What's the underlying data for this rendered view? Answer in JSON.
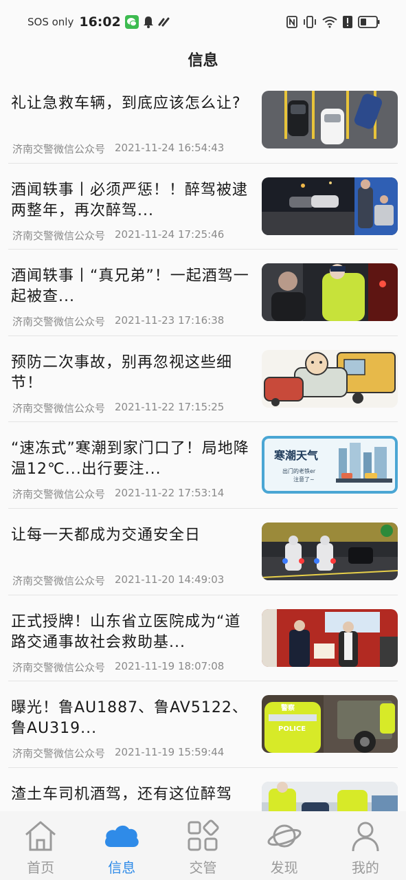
{
  "status_bar": {
    "carrier": "SOS only",
    "time": "16:02"
  },
  "header": {
    "title": "信息"
  },
  "news": [
    {
      "title": "礼让急救车辆，到底应该怎么让?",
      "source": "济南交警微信公众号",
      "time": "2021-11-24 16:54:43",
      "thumb": "parking-cars"
    },
    {
      "title": "酒闻轶事丨必须严惩！！醉驾被逮两整年，再次醉驾...",
      "source": "济南交警微信公众号",
      "time": "2021-11-24 17:25:46",
      "thumb": "night-traffic"
    },
    {
      "title": "酒闻轶事丨“真兄弟”！一起酒驾一起被查...",
      "source": "济南交警微信公众号",
      "time": "2021-11-23 17:16:38",
      "thumb": "police-check"
    },
    {
      "title": "预防二次事故，别再忽视这些细节！",
      "source": "济南交警微信公众号",
      "time": "2021-11-22 17:15:25",
      "thumb": "cartoon-accident"
    },
    {
      "title": "“速冻式”寒潮到家门口了！局地降温12℃...出行要注...",
      "source": "济南交警微信公众号",
      "time": "2021-11-22 17:53:14",
      "thumb": "cold-wave"
    },
    {
      "title": "让每一天都成为交通安全日",
      "source": "济南交警微信公众号",
      "time": "2021-11-20 14:49:03",
      "thumb": "police-motorcycles"
    },
    {
      "title": "正式授牌！山东省立医院成为“道路交通事故社会救助基...",
      "source": "济南交警微信公众号",
      "time": "2021-11-19 18:07:08",
      "thumb": "award-ceremony"
    },
    {
      "title": "曝光！鲁AU1887、鲁AV5122、鲁AU319...",
      "source": "济南交警微信公众号",
      "time": "2021-11-19 15:59:44",
      "thumb": "truck-inspection"
    },
    {
      "title": "渣土车司机酒驾，还有这位醉驾",
      "source": "",
      "time": "",
      "thumb": "drunk-driver"
    }
  ],
  "thumb_text": {
    "cold_wave_title": "寒潮天气",
    "cold_wave_sub1": "出门的老铁er",
    "cold_wave_sub2": "注意了~",
    "police_word": "警察",
    "police_en": "POLICE"
  },
  "tabs": [
    {
      "label": "首页",
      "icon": "home-icon",
      "active": false
    },
    {
      "label": "信息",
      "icon": "cloud-icon",
      "active": true
    },
    {
      "label": "交管",
      "icon": "apps-grid-icon",
      "active": false
    },
    {
      "label": "发现",
      "icon": "planet-icon",
      "active": false
    },
    {
      "label": "我的",
      "icon": "user-icon",
      "active": false
    }
  ],
  "colors": {
    "accent": "#2f8be8",
    "inactive_tab": "#9a9a9a",
    "meta_text": "#8a8a8a",
    "wechat_green": "#3dbb50"
  }
}
